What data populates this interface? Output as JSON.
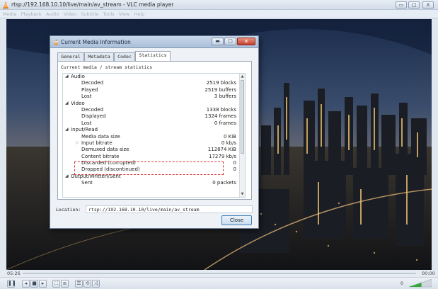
{
  "window": {
    "title": "rtsp://192.168.10.10/live/main/av_stream - VLC media player",
    "controls": {
      "minimize": "▭",
      "maximize": "□",
      "close": "X"
    }
  },
  "menu": [
    "Media",
    "Playback",
    "Audio",
    "Video",
    "Subtitle",
    "Tools",
    "View",
    "Help"
  ],
  "player": {
    "elapsed": "05:26",
    "remaining": "00:00",
    "volume": "0",
    "volume_level": 0.55,
    "icons": [
      "pause-icon",
      "previous-icon",
      "stop-icon",
      "next-icon",
      "fullscreen-icon",
      "extended-settings-icon",
      "playlist-icon",
      "loop-icon",
      "shuffle-icon"
    ]
  },
  "dialog": {
    "title": "Current Media Information",
    "tabs": [
      "General",
      "Metadata",
      "Codec",
      "Statistics"
    ],
    "active_tab": 3,
    "heading": "Current media / stream statistics",
    "rows": [
      {
        "type": "group",
        "label": "Audio"
      },
      {
        "type": "item",
        "label": "Decoded",
        "value": "2519 blocks"
      },
      {
        "type": "item",
        "label": "Played",
        "value": "2519 buffers"
      },
      {
        "type": "item",
        "label": "Lost",
        "value": "3 buffers"
      },
      {
        "type": "group",
        "label": "Video"
      },
      {
        "type": "item",
        "label": "Decoded",
        "value": "1338 blocks"
      },
      {
        "type": "item",
        "label": "Displayed",
        "value": "1324 frames"
      },
      {
        "type": "item",
        "label": "Lost",
        "value": "0 frames"
      },
      {
        "type": "group",
        "label": "Input/Read"
      },
      {
        "type": "item",
        "label": "Media data size",
        "value": "0 KiB"
      },
      {
        "type": "subgroup",
        "label": "Input bitrate",
        "value": "0 kb/s"
      },
      {
        "type": "item",
        "label": "Demuxed data size",
        "value": "112874 KiB"
      },
      {
        "type": "item",
        "label": "Content bitrate",
        "value": "17279 kb/s"
      },
      {
        "type": "item",
        "label": "Discarded (corrupted)",
        "value": "0"
      },
      {
        "type": "item",
        "label": "Dropped (discontinued)",
        "value": "0"
      },
      {
        "type": "group",
        "label": "Output/Written/Sent"
      },
      {
        "type": "item",
        "label": "Sent",
        "value": "0 packets"
      }
    ],
    "location_label": "Location:",
    "location_value": "rtsp://192.168.10.10/live/main/av_stream",
    "close_label": "Close"
  },
  "colors": {
    "highlight": "#d0322a",
    "accent": "#3f7fb8",
    "volume": "#3aa63a"
  }
}
